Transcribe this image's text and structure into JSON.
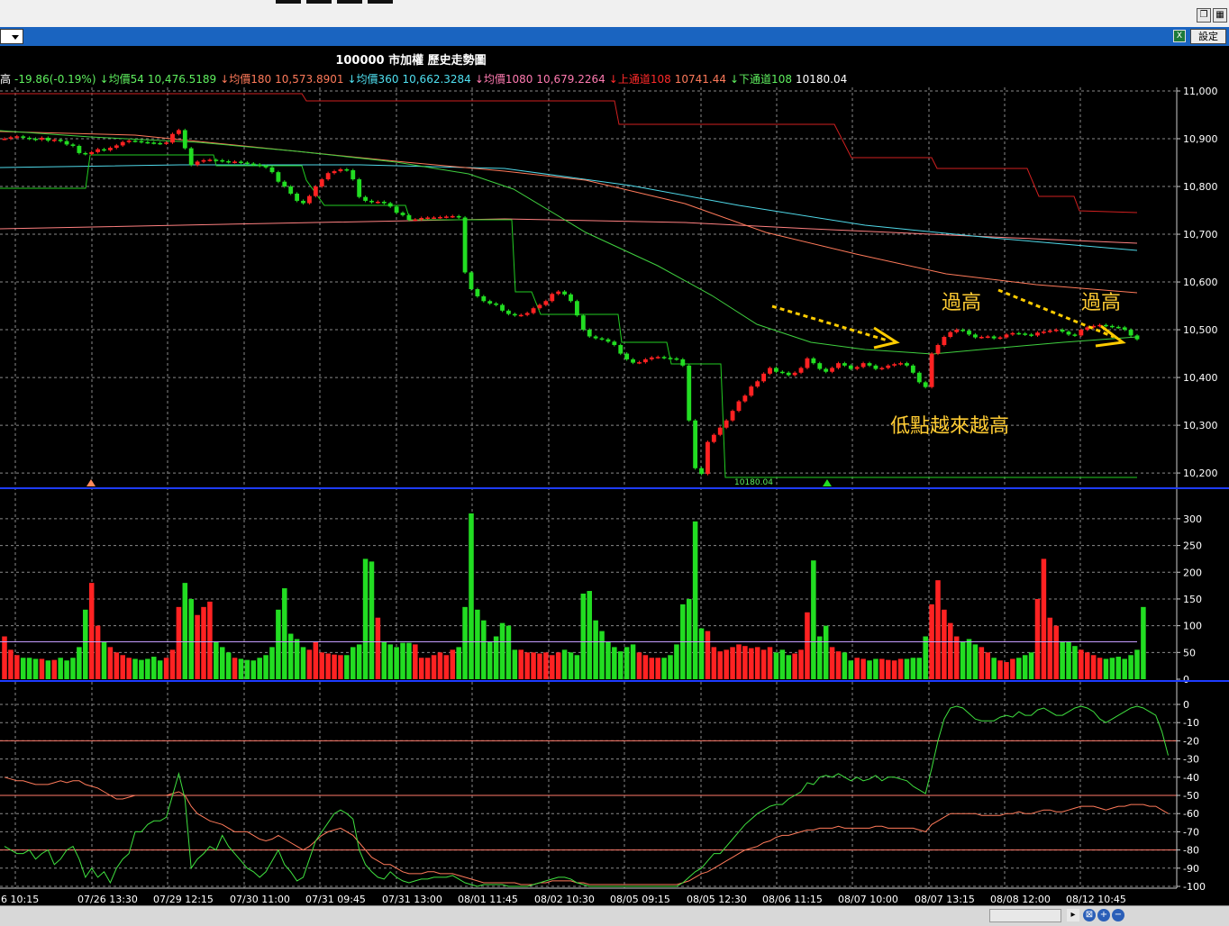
{
  "window": {
    "settings_label": "設定"
  },
  "chart_title": "100000 市加權   歷史走勢圖",
  "indicators": [
    {
      "label": "高",
      "value": "-19.86(-0.19%)",
      "label_color": "#ffffff",
      "value_color": "#5ff05f"
    },
    {
      "label": "↓均價54",
      "value": "10,476.5189",
      "label_color": "#5ff05f",
      "value_color": "#5ff05f"
    },
    {
      "label": "↓均價180",
      "value": "10,573.8901",
      "label_color": "#ff7a5a",
      "value_color": "#ff7a5a"
    },
    {
      "label": "↓均價360",
      "value": "10,662.3284",
      "label_color": "#4fe0f0",
      "value_color": "#4fe0f0"
    },
    {
      "label": "↓均價1080",
      "value": "10,679.2264",
      "label_color": "#ff7ab0",
      "value_color": "#ff7ab0"
    },
    {
      "label": "↓上通道108",
      "value": "10741.44",
      "label_color": "#ff2a2a",
      "value_color": "#ff7a5a"
    },
    {
      "label": "↓下通道108",
      "value": "10180.04",
      "label_color": "#5ff05f",
      "value_color": "#ffffff"
    }
  ],
  "annotations": {
    "higher_high_left": "過高",
    "higher_high_right": "過高",
    "rising_lows": "低點越來越高",
    "low_marker": "10180.04"
  },
  "colors": {
    "up": "#ff2222",
    "down": "#22dd22",
    "grid": "#8a8a8a",
    "axis_divider": "#1e3cff",
    "upper_channel": "#d02020",
    "lower_channel": "#22cc22",
    "ma54": "#3fcf3f",
    "ma180": "#ff7a5a",
    "ma360": "#4fd8e8",
    "ma1080": "#ff8080",
    "annotation_text": "#ffcc33",
    "annotation_arrow": "#ffcc00"
  },
  "chart_data": [
    {
      "type": "candlestick",
      "title": "100000 市加權   歷史走勢圖",
      "ylim": [
        10170,
        11000
      ],
      "y_ticks": [
        10200,
        10300,
        10400,
        10500,
        10600,
        10700,
        10800,
        10900,
        11000
      ],
      "close": [
        10900,
        10903,
        10905,
        10902,
        10900,
        10898,
        10902,
        10896,
        10898,
        10895,
        10888,
        10885,
        10870,
        10868,
        10872,
        10878,
        10876,
        10881,
        10886,
        10893,
        10896,
        10895,
        10893,
        10892,
        10891,
        10890,
        10892,
        10910,
        10918,
        10880,
        10845,
        10852,
        10855,
        10856,
        10855,
        10853,
        10851,
        10852,
        10850,
        10848,
        10846,
        10843,
        10840,
        10830,
        10810,
        10800,
        10785,
        10770,
        10765,
        10780,
        10800,
        10815,
        10828,
        10832,
        10836,
        10834,
        10815,
        10778,
        10770,
        10767,
        10768,
        10765,
        10758,
        10745,
        10740,
        10730,
        10731,
        10734,
        10735,
        10735,
        10736,
        10737,
        10738,
        10735,
        10620,
        10585,
        10570,
        10560,
        10555,
        10552,
        10540,
        10533,
        10530,
        10531,
        10535,
        10545,
        10552,
        10560,
        10575,
        10580,
        10574,
        10560,
        10530,
        10500,
        10486,
        10482,
        10480,
        10475,
        10468,
        10450,
        10438,
        10431,
        10432,
        10438,
        10442,
        10443,
        10441,
        10440,
        10438,
        10425,
        10310,
        10210,
        10198,
        10265,
        10280,
        10295,
        10310,
        10330,
        10350,
        10362,
        10381,
        10392,
        10408,
        10420,
        10412,
        10410,
        10405,
        10410,
        10420,
        10440,
        10430,
        10418,
        10412,
        10420,
        10430,
        10425,
        10418,
        10422,
        10430,
        10425,
        10418,
        10420,
        10425,
        10428,
        10430,
        10425,
        10410,
        10390,
        10380,
        10450,
        10468,
        10485,
        10495,
        10500,
        10498,
        10490,
        10484,
        10485,
        10486,
        10482,
        10484,
        10490,
        10493,
        10492,
        10490,
        10488,
        10494,
        10496,
        10498,
        10500,
        10496,
        10490,
        10488,
        10500,
        10505,
        10508,
        10510,
        10508,
        10506,
        10505,
        10500,
        10488,
        10480
      ],
      "lower_channel_108": 10180.04,
      "upper_channel_108": 10741.44,
      "ma54": 10476.5189,
      "ma180": 10573.8901,
      "ma360": 10662.3284,
      "ma1080": 10679.2264
    },
    {
      "type": "bar",
      "title": "volume",
      "ylim": [
        0,
        320
      ],
      "y_ticks": [
        0,
        50,
        100,
        150,
        200,
        250,
        300
      ],
      "values": [
        80,
        55,
        45,
        40,
        40,
        38,
        38,
        35,
        36,
        40,
        35,
        40,
        60,
        130,
        180,
        100,
        70,
        60,
        50,
        45,
        40,
        38,
        36,
        38,
        42,
        35,
        40,
        55,
        135,
        180,
        150,
        120,
        135,
        145,
        70,
        60,
        50,
        40,
        38,
        36,
        35,
        40,
        45,
        60,
        130,
        170,
        85,
        75,
        60,
        55,
        70,
        50,
        48,
        46,
        45,
        45,
        60,
        65,
        225,
        220,
        115,
        70,
        65,
        60,
        68,
        68,
        65,
        40,
        40,
        45,
        50,
        45,
        55,
        60,
        135,
        310,
        130,
        110,
        70,
        80,
        105,
        100,
        55,
        55,
        50,
        50,
        48,
        50,
        45,
        50,
        55,
        50,
        45,
        160,
        165,
        110,
        90,
        70,
        60,
        52,
        60,
        65,
        50,
        45,
        40,
        40,
        40,
        45,
        65,
        140,
        150,
        295,
        95,
        90,
        60,
        52,
        55,
        60,
        65,
        62,
        58,
        60,
        55,
        60,
        50,
        55,
        45,
        48,
        55,
        125,
        222,
        80,
        100,
        60,
        52,
        50,
        35,
        40,
        38,
        35,
        38,
        38,
        36,
        35,
        38,
        38,
        40,
        40,
        80,
        140,
        185,
        130,
        105,
        80,
        70,
        75,
        65,
        60,
        50,
        40,
        35,
        32,
        38,
        40,
        45,
        50,
        150,
        225,
        115,
        100,
        70,
        70,
        62,
        55,
        50,
        45,
        40,
        38,
        40,
        42,
        38,
        45,
        55,
        135
      ],
      "values_color_pattern": "red=up, green=down"
    },
    {
      "type": "line",
      "title": "oscillator",
      "ylim": [
        -100,
        0
      ],
      "y_ticks": [
        0,
        -10,
        -20,
        -30,
        -40,
        -50,
        -60,
        -70,
        -80,
        -90,
        -100
      ],
      "reference_lines": [
        -20,
        -50,
        -80
      ],
      "series": [
        {
          "values": [
            -78,
            -80,
            -82,
            -82,
            -80,
            -85,
            -82,
            -80,
            -88,
            -85,
            -80,
            -78,
            -85,
            -95,
            -90,
            -95,
            -92,
            -98,
            -90,
            -85,
            -82,
            -70,
            -70,
            -66,
            -64,
            -64,
            -62,
            -50,
            -38,
            -52,
            -90,
            -85,
            -82,
            -78,
            -80,
            -72,
            -78,
            -82,
            -86,
            -90,
            -92,
            -95,
            -92,
            -86,
            -80,
            -88,
            -92,
            -97,
            -95,
            -85,
            -75,
            -70,
            -65,
            -60,
            -58,
            -60,
            -63,
            -80,
            -88,
            -92,
            -95,
            -96,
            -92,
            -95,
            -97,
            -98,
            -97,
            -96,
            -96,
            -95,
            -95,
            -95,
            -94,
            -96,
            -98,
            -99,
            -100,
            -99,
            -99,
            -99,
            -99,
            -100,
            -100,
            -100,
            -100,
            -99,
            -98,
            -97,
            -96,
            -95,
            -95,
            -96,
            -98,
            -99,
            -100,
            -100,
            -100,
            -100,
            -100,
            -100,
            -100,
            -100,
            -100,
            -100,
            -100,
            -100,
            -100,
            -100,
            -100,
            -98,
            -95,
            -92,
            -90,
            -86,
            -82,
            -82,
            -78,
            -74,
            -70,
            -66,
            -63,
            -60,
            -58,
            -56,
            -55,
            -55,
            -52,
            -50,
            -48,
            -43,
            -44,
            -40,
            -39,
            -40,
            -38,
            -40,
            -42,
            -40,
            -42,
            -41,
            -39,
            -42,
            -40,
            -40,
            -41,
            -42,
            -45,
            -47,
            -49,
            -35,
            -20,
            -8,
            -2,
            -1,
            -2,
            -5,
            -8,
            -9,
            -9,
            -9,
            -7,
            -6,
            -7,
            -4,
            -6,
            -6,
            -3,
            -2,
            -4,
            -6,
            -6,
            -4,
            -2,
            -1,
            -2,
            -4,
            -8,
            -10,
            -8,
            -6,
            -4,
            -2,
            -1,
            -2,
            -4,
            -6,
            -15,
            -28
          ]
        },
        {
          "values": [
            -40,
            -41,
            -42,
            -42,
            -43,
            -44,
            -44,
            -44,
            -43,
            -42,
            -43,
            -42,
            -42,
            -44,
            -45,
            -46,
            -48,
            -50,
            -52,
            -52,
            -51,
            -50,
            -50,
            -50,
            -50,
            -50,
            -50,
            -49,
            -48,
            -50,
            -56,
            -60,
            -62,
            -64,
            -65,
            -66,
            -68,
            -70,
            -70,
            -70,
            -72,
            -74,
            -75,
            -74,
            -72,
            -74,
            -76,
            -78,
            -80,
            -78,
            -75,
            -72,
            -70,
            -69,
            -68,
            -70,
            -72,
            -76,
            -80,
            -84,
            -86,
            -88,
            -88,
            -90,
            -92,
            -93,
            -93,
            -93,
            -92,
            -92,
            -93,
            -93,
            -93,
            -94,
            -95,
            -96,
            -97,
            -98,
            -98,
            -98,
            -98,
            -98,
            -98,
            -99,
            -99,
            -99,
            -98,
            -98,
            -97,
            -97,
            -97,
            -97,
            -98,
            -98,
            -99,
            -99,
            -99,
            -99,
            -99,
            -99,
            -99,
            -99,
            -99,
            -99,
            -99,
            -99,
            -99,
            -99,
            -99,
            -98,
            -97,
            -95,
            -93,
            -92,
            -90,
            -88,
            -86,
            -84,
            -82,
            -80,
            -79,
            -78,
            -76,
            -75,
            -73,
            -72,
            -72,
            -71,
            -70,
            -69,
            -69,
            -68,
            -68,
            -68,
            -67,
            -68,
            -68,
            -68,
            -68,
            -68,
            -67,
            -67,
            -68,
            -68,
            -68,
            -68,
            -68,
            -69,
            -70,
            -66,
            -64,
            -62,
            -60,
            -60,
            -60,
            -60,
            -60,
            -61,
            -61,
            -61,
            -61,
            -60,
            -60,
            -59,
            -60,
            -60,
            -59,
            -58,
            -58,
            -59,
            -59,
            -58,
            -57,
            -56,
            -56,
            -56,
            -57,
            -58,
            -57,
            -56,
            -56,
            -55,
            -55,
            -55,
            -56,
            -56,
            -58,
            -60
          ]
        }
      ]
    }
  ],
  "x_axis_labels": [
    "6 10:15",
    "07/26 13:30",
    "07/29 12:15",
    "07/30 11:00",
    "07/31 09:45",
    "07/31 13:00",
    "08/01 11:45",
    "08/02 10:30",
    "08/05 09:15",
    "08/05 12:30",
    "08/06 11:15",
    "08/07 10:00",
    "08/07 13:15",
    "08/08 12:00",
    "08/12 10:45"
  ]
}
